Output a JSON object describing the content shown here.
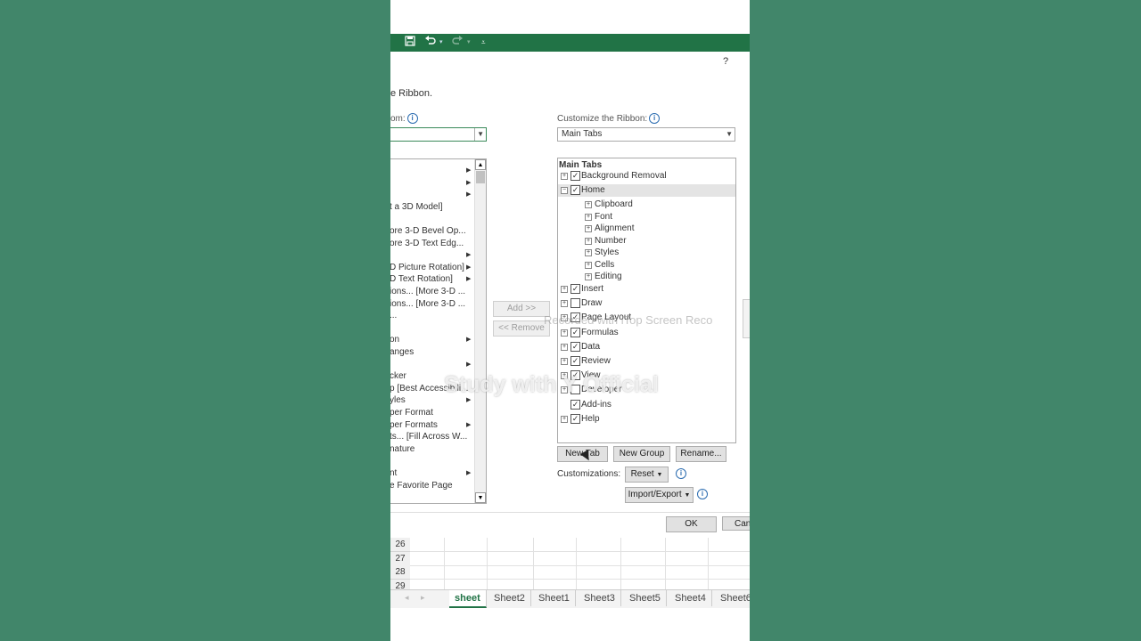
{
  "qat": {
    "save_icon": "save-icon",
    "undo_icon": "undo-icon",
    "redo_icon": "redo-icon",
    "customize_icon": "qat-dropdown-icon"
  },
  "dialog": {
    "help": "?",
    "heading": "e Ribbon.",
    "left_label": "om:",
    "right_label": "Customize the Ribbon:",
    "right_combo_value": "Main Tabs",
    "left_items": [
      {
        "text": "",
        "arrow": true
      },
      {
        "text": "",
        "arrow": true
      },
      {
        "text": "",
        "arrow": true
      },
      {
        "text": "t a 3D Model]",
        "arrow": false
      },
      {
        "text": "",
        "arrow": false
      },
      {
        "text": "ore 3-D Bevel Op...",
        "arrow": false
      },
      {
        "text": "ore 3-D Text Edg...",
        "arrow": false
      },
      {
        "text": "",
        "arrow": true
      },
      {
        "text": "D Picture Rotation]",
        "arrow": true
      },
      {
        "text": "D Text Rotation]",
        "arrow": true
      },
      {
        "text": "ions... [More 3-D ...",
        "arrow": false
      },
      {
        "text": "ions... [More 3-D ...",
        "arrow": false
      },
      {
        "text": "...",
        "arrow": false
      },
      {
        "text": "",
        "arrow": false
      },
      {
        "text": "on",
        "arrow": true
      },
      {
        "text": "anges",
        "arrow": false
      },
      {
        "text": "",
        "arrow": true
      },
      {
        "text": "cker",
        "arrow": false
      },
      {
        "text": "p [Best Accessibili...",
        "arrow": false
      },
      {
        "text": "yles",
        "arrow": true
      },
      {
        "text": "per Format",
        "arrow": false
      },
      {
        "text": "per Formats",
        "arrow": true
      },
      {
        "text": "ts... [Fill Across W...",
        "arrow": false
      },
      {
        "text": "nature",
        "arrow": false
      },
      {
        "text": "",
        "arrow": false
      },
      {
        "text": "nt",
        "arrow": true
      },
      {
        "text": "e Favorite Page",
        "arrow": false
      }
    ],
    "add_button": "Add >>",
    "remove_button": "<< Remove",
    "tree_header": "Main Tabs",
    "tree": [
      {
        "label": "Background Removal",
        "level": 0,
        "checked": true,
        "exp": "+"
      },
      {
        "label": "Home",
        "level": 0,
        "checked": true,
        "exp": "−",
        "selected": true
      },
      {
        "label": "Clipboard",
        "level": 1,
        "exp": "+"
      },
      {
        "label": "Font",
        "level": 1,
        "exp": "+"
      },
      {
        "label": "Alignment",
        "level": 1,
        "exp": "+"
      },
      {
        "label": "Number",
        "level": 1,
        "exp": "+"
      },
      {
        "label": "Styles",
        "level": 1,
        "exp": "+"
      },
      {
        "label": "Cells",
        "level": 1,
        "exp": "+"
      },
      {
        "label": "Editing",
        "level": 1,
        "exp": "+"
      },
      {
        "label": "Insert",
        "level": 0,
        "checked": true,
        "exp": "+"
      },
      {
        "label": "Draw",
        "level": 0,
        "checked": false,
        "exp": "+"
      },
      {
        "label": "Page Layout",
        "level": 0,
        "checked": true,
        "exp": "+"
      },
      {
        "label": "Formulas",
        "level": 0,
        "checked": true,
        "exp": "+"
      },
      {
        "label": "Data",
        "level": 0,
        "checked": true,
        "exp": "+"
      },
      {
        "label": "Review",
        "level": 0,
        "checked": true,
        "exp": "+"
      },
      {
        "label": "View",
        "level": 0,
        "checked": true,
        "exp": "+"
      },
      {
        "label": "Developer",
        "level": 0,
        "checked": false,
        "exp": "+"
      },
      {
        "label": "Add-ins",
        "level": 0,
        "checked": true,
        "exp": ""
      },
      {
        "label": "Help",
        "level": 0,
        "checked": true,
        "exp": "+"
      }
    ],
    "new_tab": "New Tab",
    "new_group": "New Group",
    "rename": "Rename...",
    "customizations_label": "Customizations:",
    "reset": "Reset",
    "import_export": "Import/Export",
    "ok": "OK",
    "cancel": "Can"
  },
  "grid": {
    "rows": [
      "26",
      "27",
      "28",
      "29"
    ]
  },
  "sheets": [
    "sheet",
    "Sheet2",
    "Sheet1",
    "Sheet3",
    "Sheet5",
    "Sheet4",
    "Sheet6"
  ],
  "watermark": {
    "main": "Study with Y Official",
    "secondary": "Recorded with iTop Screen Reco"
  }
}
